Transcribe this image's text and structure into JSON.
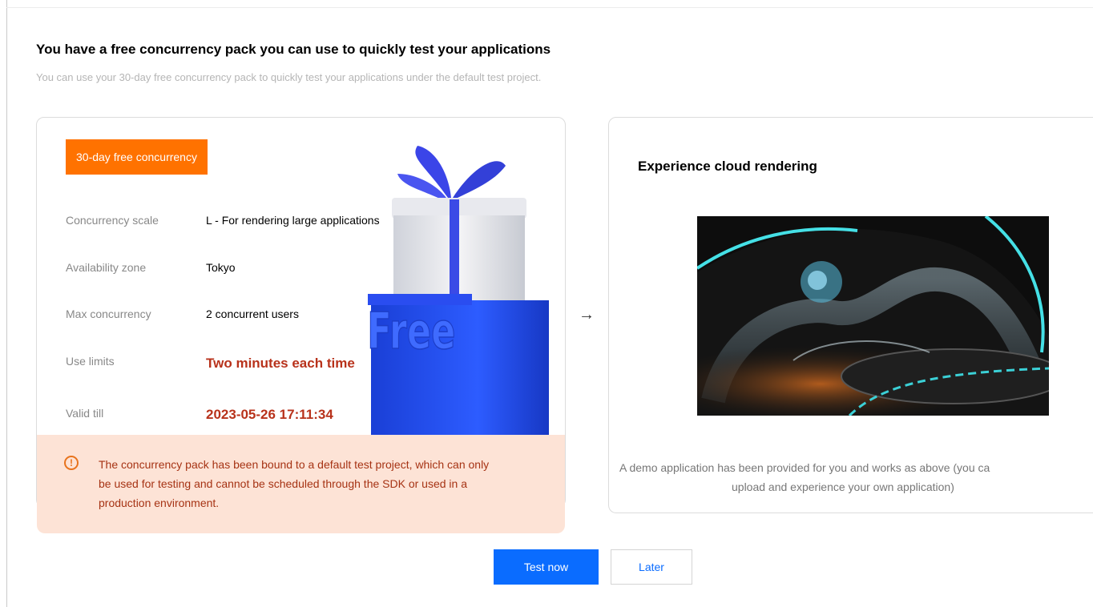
{
  "header": {
    "title": "You have a free concurrency pack you can use to quickly test your applications",
    "subtitle": "You can use your 30-day free concurrency pack to quickly test your applications under the default test project."
  },
  "pack": {
    "badge": "30-day free concurrency",
    "gift_text": "Free",
    "rows": [
      {
        "label": "Concurrency scale",
        "value": "L - For rendering large applications"
      },
      {
        "label": "Availability zone",
        "value": "Tokyo"
      },
      {
        "label": "Max concurrency",
        "value": "2 concurrent users"
      },
      {
        "label": "Use limits",
        "value": "Two minutes each time"
      },
      {
        "label": "Valid till",
        "value": "2023-05-26 17:11:34"
      }
    ],
    "notice": "The concurrency pack has been bound to a default test project, which can only be used for testing and cannot be scheduled through the SDK or used in a production environment."
  },
  "demo": {
    "title": "Experience cloud rendering",
    "caption_line1": "A demo application has been provided for you and works as above (you ca",
    "caption_line2": "upload and experience your own application)"
  },
  "actions": {
    "primary": "Test now",
    "secondary": "Later"
  },
  "colors": {
    "accent": "#0a6cff",
    "badge": "#ff7200",
    "highlight_red": "#b8321b",
    "notice_bg": "#fde3d6"
  }
}
